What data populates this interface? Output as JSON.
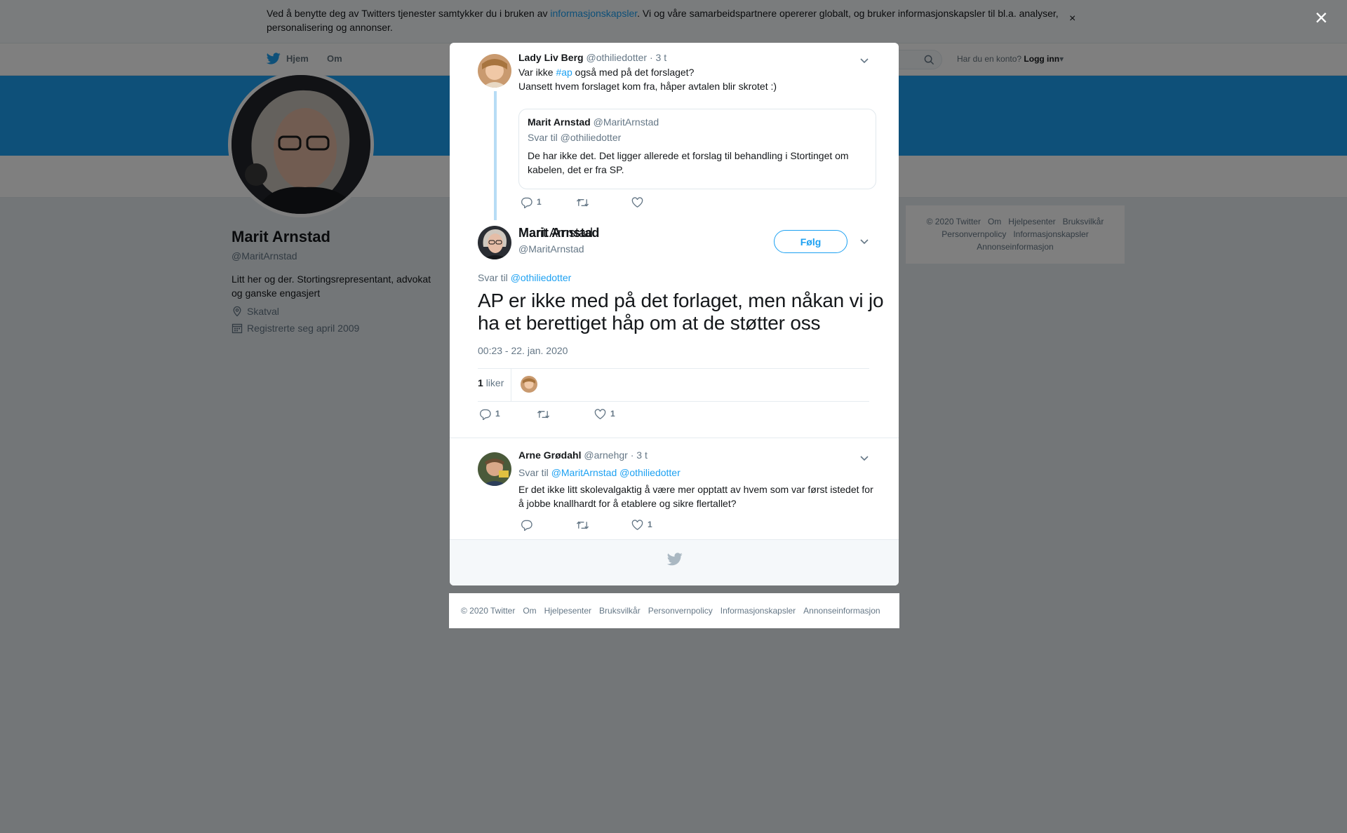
{
  "cookie_bar": {
    "text_before": "Ved å benytte deg av Twitters tjenester samtykker du i bruken av ",
    "link": "informasjonskapsler",
    "text_after": ". Vi og våre samarbeidspartnere opererer globalt, og bruker informasjonskapsler til bl.a. analyser, personalisering og annonser.",
    "close": "×"
  },
  "nav": {
    "home": "Hjem",
    "about": "Om",
    "login_prompt": "Har du en konto?",
    "login": "Logg inn"
  },
  "profile": {
    "name": "Marit Arnstad",
    "handle": "@MaritArnstad",
    "bio": "Litt her og der. Stortingsrepresentant, advokat og ganske engasjert",
    "location": "Skatval",
    "joined": "Registrerte seg april 2009"
  },
  "right_footer": [
    "© 2020 Twitter",
    "Om",
    "Hjelpesenter",
    "Bruksvilkår",
    "Personvernpolicy",
    "Informasjonskapsler",
    "Annonseinformasjon"
  ],
  "overlay_close": "×",
  "parent_tweet": {
    "name": "Lady Liv Berg",
    "handle": "@othiliedotter",
    "time": "· 3 t",
    "line1_before": "Var ikke ",
    "hashtag": "#ap",
    "line1_after": " også med på det forslaget?",
    "line2": "Uansett hvem forslaget kom fra, håper avtalen blir skrotet :)",
    "quote": {
      "name": "Marit Arnstad",
      "handle": "@MaritArnstad",
      "reply_to": "Svar til @othiliedotter",
      "text": "De har ikke det. Det ligger allerede et forslag til behandling i Stortinget om kabelen, det er fra SP."
    },
    "reply_count": "1",
    "retweet_count": "",
    "like_count": ""
  },
  "main_tweet": {
    "name": "Marit Arnstad",
    "handle": "@MaritArnstad",
    "follow": "Følg",
    "reply_label": "Svar til",
    "reply_to": "@othiliedotter",
    "text": "AP er ikke med på det forlaget, men nåkan vi jo ha et berettiget håp om at de støtter oss",
    "timestamp": "00:23 - 22. jan. 2020",
    "likes_num": "1",
    "likes_label": "liker",
    "reply_count": "1",
    "retweet_count": "",
    "like_count": "1"
  },
  "reply_tweet": {
    "name": "Arne Grødahl",
    "handle": "@arnehgr",
    "time": "· 3 t",
    "reply_label": "Svar til",
    "reply_to": "@MaritArnstad @othiliedotter",
    "text": "Er det ikke litt skolevalgaktig å være mer opptatt av hvem som var først istedet for å jobbe knallhardt for å etablere og sikre flertallet?",
    "reply_count": "",
    "retweet_count": "",
    "like_count": "1"
  },
  "bottom_footer": [
    "© 2020 Twitter",
    "Om",
    "Hjelpesenter",
    "Bruksvilkår",
    "Personvernpolicy",
    "Informasjonskapsler",
    "Annonseinformasjon"
  ],
  "colors": {
    "brand": "#1da1f2",
    "overlay": "rgba(0,0,0,0.5)",
    "thread_line": "#b7dcf5"
  }
}
